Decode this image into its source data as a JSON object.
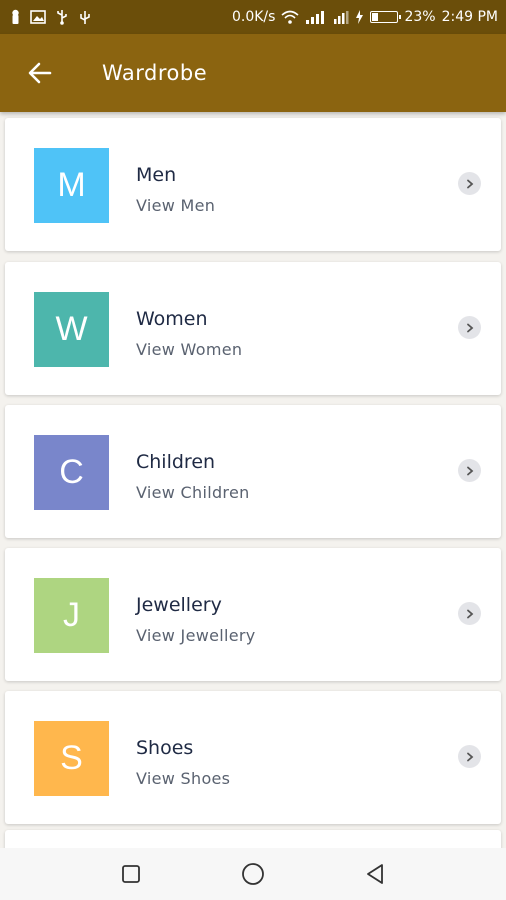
{
  "status_bar": {
    "speed": "0.0K/s",
    "battery_percent": "23%",
    "battery_level": 0.23,
    "time": "2:49 PM"
  },
  "app_bar": {
    "title": "Wardrobe",
    "back_icon": "arrow-left-icon"
  },
  "categories": [
    {
      "letter": "M",
      "title": "Men",
      "subtitle": "View Men",
      "color": "#4fc3f7"
    },
    {
      "letter": "W",
      "title": "Women",
      "subtitle": "View Women",
      "color": "#4db6ac"
    },
    {
      "letter": "C",
      "title": "Children",
      "subtitle": "View Children",
      "color": "#7986cb"
    },
    {
      "letter": "J",
      "title": "Jewellery",
      "subtitle": "View Jewellery",
      "color": "#aed581"
    },
    {
      "letter": "S",
      "title": "Shoes",
      "subtitle": "View Shoes",
      "color": "#ffb74d"
    }
  ],
  "colors": {
    "status_bar": "#6b4e0a",
    "app_bar": "#8b6410",
    "title_text": "#1f2a44",
    "subtitle_text": "#5a6270"
  },
  "nav_bar": {
    "icons": [
      "recents-square-icon",
      "home-circle-icon",
      "back-triangle-icon"
    ]
  }
}
